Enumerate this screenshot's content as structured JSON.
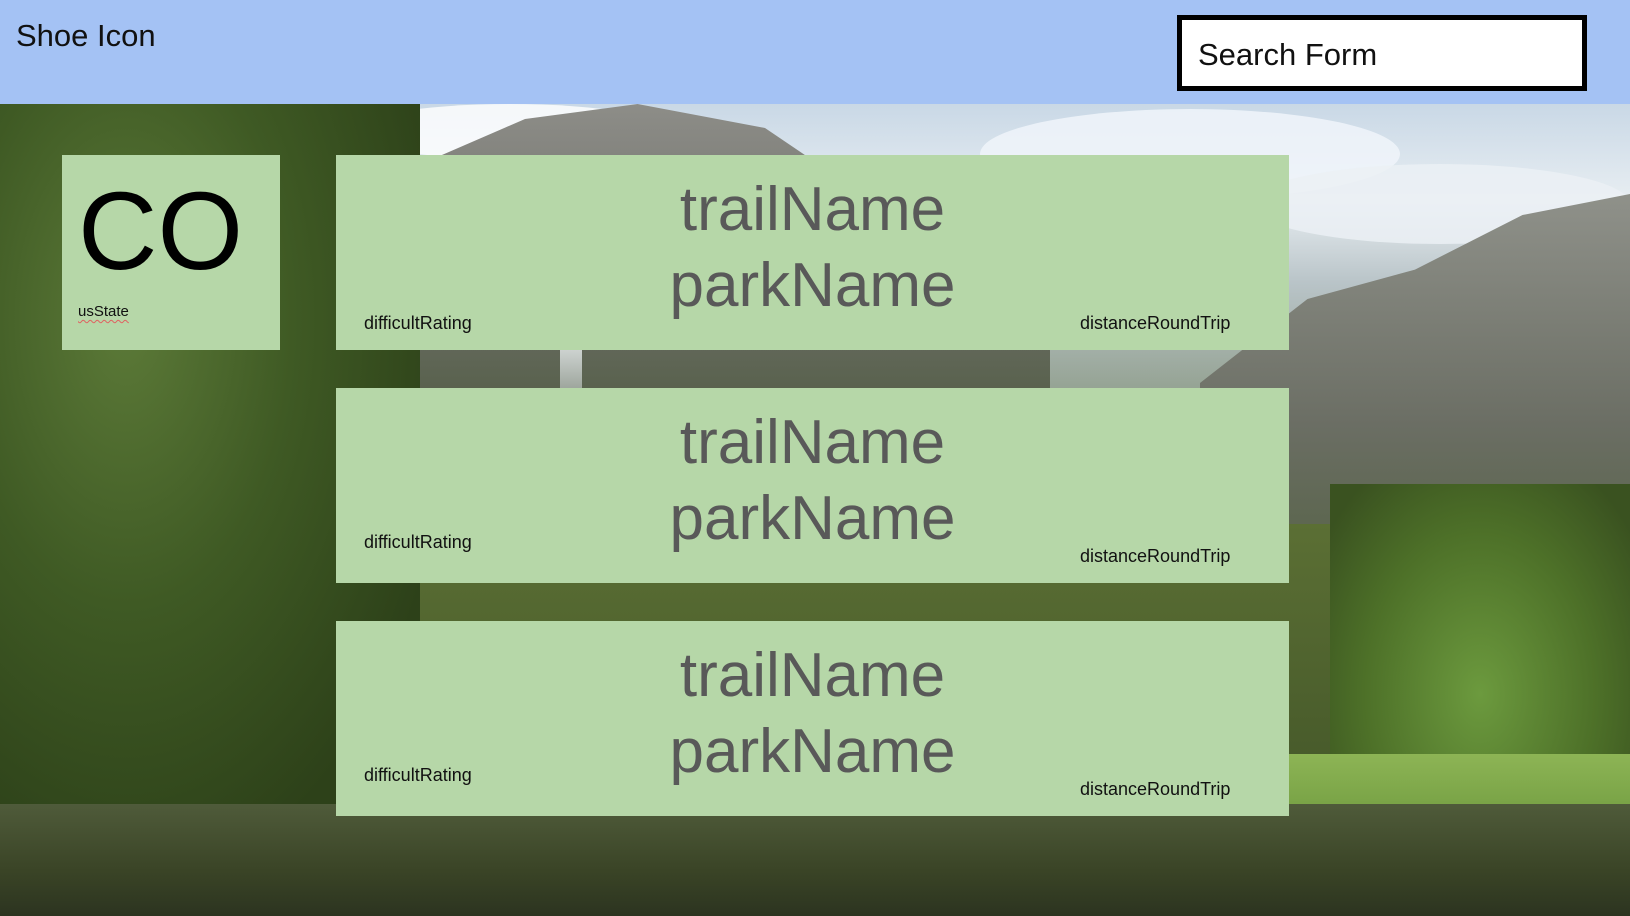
{
  "header": {
    "logo_text": "Shoe Icon",
    "search_label": "Search Form"
  },
  "state_card": {
    "code": "CO",
    "label": "usState"
  },
  "trails": [
    {
      "trail_name": "trailName",
      "park_name": "parkName",
      "difficulty_label": "difficultRating",
      "distance_label": "distanceRoundTrip"
    },
    {
      "trail_name": "trailName",
      "park_name": "parkName",
      "difficulty_label": "difficultRating",
      "distance_label": "distanceRoundTrip"
    },
    {
      "trail_name": "trailName",
      "park_name": "parkName",
      "difficulty_label": "difficultRating",
      "distance_label": "distanceRoundTrip"
    }
  ],
  "colors": {
    "header_bg": "#a4c2f4",
    "card_bg": "#b6d7a8",
    "title_text": "#595959"
  },
  "icons": {
    "background": "landscape-photo"
  }
}
